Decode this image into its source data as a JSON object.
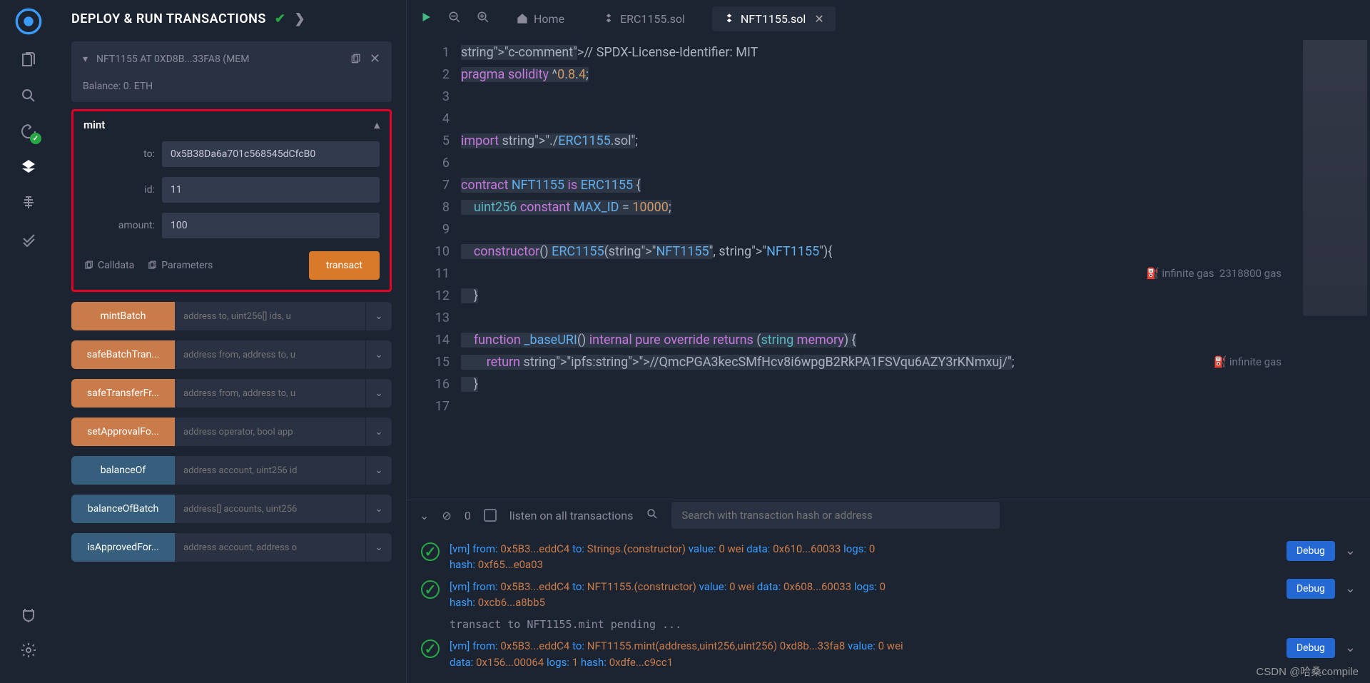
{
  "panel": {
    "title": "DEPLOY & RUN TRANSACTIONS",
    "contract": {
      "name": "NFT1155 AT 0XD8B...33FA8 (MEM",
      "balance": "Balance: 0. ETH"
    },
    "mint": {
      "title": "mint",
      "to_label": "to:",
      "to_value": "0x5B38Da6a701c568545dCfcB0",
      "id_label": "id:",
      "id_value": "11",
      "amount_label": "amount:",
      "amount_value": "100",
      "calldata": "Calldata",
      "parameters": "Parameters",
      "transact": "transact"
    },
    "functions": [
      {
        "name": "mintBatch",
        "kind": "orange",
        "args": "address to, uint256[] ids, u"
      },
      {
        "name": "safeBatchTran...",
        "kind": "orange",
        "args": "address from, address to, u"
      },
      {
        "name": "safeTransferFr...",
        "kind": "orange",
        "args": "address from, address to, u"
      },
      {
        "name": "setApprovalFo...",
        "kind": "orange",
        "args": "address operator, bool app"
      },
      {
        "name": "balanceOf",
        "kind": "blue",
        "args": "address account, uint256 id"
      },
      {
        "name": "balanceOfBatch",
        "kind": "blue",
        "args": "address[] accounts, uint256"
      },
      {
        "name": "isApprovedFor...",
        "kind": "blue",
        "args": "address account, address o"
      }
    ]
  },
  "tabs": {
    "home": "Home",
    "erc": "ERC1155.sol",
    "nft": "NFT1155.sol"
  },
  "code": {
    "lines": [
      "// SPDX-License-Identifier: MIT",
      "pragma solidity ^0.8.4;",
      "",
      "",
      "import \"./ERC1155.sol\";",
      "",
      "contract NFT1155 is ERC1155 {",
      "    uint256 constant MAX_ID = 10000;",
      "",
      "    constructor() ERC1155(\"NFT1155\", \"NFT1155\"){",
      "",
      "    }",
      "",
      "    function _baseURI() internal pure override returns (string memory) {",
      "        return \"ipfs://QmcPGA3kecSMfHcv8i6wpgB2RkPA1FSVqu6AZY3rKNmxuj/\";",
      "    }",
      ""
    ],
    "gas_hint_10": "infinite gas  2318800 gas",
    "gas_hint_14": "infinite gas"
  },
  "termbar": {
    "zero": "0",
    "listen": "listen on all transactions",
    "search_placeholder": "Search with transaction hash or address"
  },
  "terminal": {
    "tx1": {
      "line1_a": "[vm]",
      "line1_b": "from:",
      "line1_c": "0x5B3...eddC4",
      "line1_d": "to:",
      "line1_e": "Strings.(constructor)",
      "line1_f": "value:",
      "line1_g": "0 wei",
      "line1_h": "data:",
      "line1_i": "0x610...60033",
      "line1_j": "logs:",
      "line1_k": "0",
      "line2_a": "hash:",
      "line2_b": "0xf65...e0a03",
      "debug": "Debug"
    },
    "tx2": {
      "line1_a": "[vm]",
      "line1_b": "from:",
      "line1_c": "0x5B3...eddC4",
      "line1_d": "to:",
      "line1_e": "NFT1155.(constructor)",
      "line1_f": "value:",
      "line1_g": "0 wei",
      "line1_h": "data:",
      "line1_i": "0x608...60033",
      "line1_j": "logs:",
      "line1_k": "0",
      "line2_a": "hash:",
      "line2_b": "0xcb6...a8bb5",
      "debug": "Debug"
    },
    "pending": "transact to NFT1155.mint pending ...",
    "tx3": {
      "line1_a": "[vm]",
      "line1_b": "from:",
      "line1_c": "0x5B3...eddC4",
      "line1_d": "to:",
      "line1_e": "NFT1155.mint(address,uint256,uint256) 0xd8b...33fa8",
      "line1_f": "value:",
      "line1_g": "0 wei",
      "line2_a": "data:",
      "line2_b": "0x156...00064",
      "line2_c": "logs:",
      "line2_d": "1",
      "line2_e": "hash:",
      "line2_f": "0xdfe...c9cc1",
      "debug": "Debug"
    }
  },
  "watermark": "CSDN @哈桑compile"
}
